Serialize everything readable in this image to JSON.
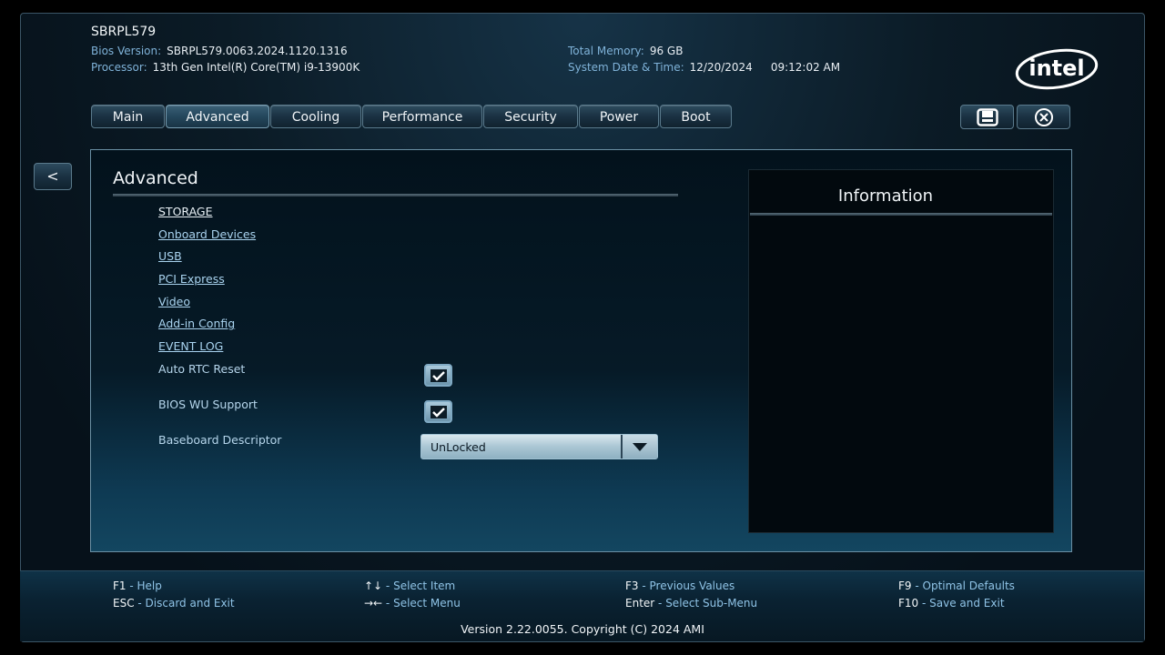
{
  "header": {
    "system_name": "SBRPL579",
    "bios_version_label": "Bios Version:",
    "bios_version_value": "SBRPL579.0063.2024.1120.1316",
    "processor_label": "Processor:",
    "processor_value": "13th Gen Intel(R) Core(TM) i9-13900K",
    "total_memory_label": "Total Memory:",
    "total_memory_value": "96 GB",
    "datetime_label": "System Date & Time:",
    "date_value": "12/20/2024",
    "time_value": "09:12:02 AM",
    "logo_text": "intel"
  },
  "tabs": [
    {
      "label": "Main"
    },
    {
      "label": "Advanced",
      "active": true
    },
    {
      "label": "Cooling"
    },
    {
      "label": "Performance"
    },
    {
      "label": "Security"
    },
    {
      "label": "Power"
    },
    {
      "label": "Boot"
    }
  ],
  "toolbar": {
    "save_icon": "save-icon",
    "close_icon": "close-icon"
  },
  "back_button": {
    "label": "<"
  },
  "panel": {
    "title": "Advanced",
    "links": [
      "STORAGE",
      "Onboard Devices",
      "USB",
      "PCI Express",
      "Video",
      "Add-in Config",
      "EVENT LOG"
    ],
    "options": {
      "auto_rtc_reset": {
        "label": "Auto RTC Reset",
        "checked": true
      },
      "bios_wu_support": {
        "label": "BIOS WU Support",
        "checked": true
      },
      "baseboard_descriptor": {
        "label": "Baseboard Descriptor",
        "value": "UnLocked"
      }
    }
  },
  "info": {
    "title": "Information"
  },
  "footer": {
    "keys": [
      {
        "key": "F1",
        "desc": "Help"
      },
      {
        "key": "ESC",
        "desc": "Discard and Exit"
      },
      {
        "key": "↑↓",
        "desc": "Select Item"
      },
      {
        "key": "→←",
        "desc": "Select Menu"
      },
      {
        "key": "F3",
        "desc": "Previous Values"
      },
      {
        "key": "Enter",
        "desc": "Select Sub-Menu"
      },
      {
        "key": "F9",
        "desc": "Optimal Defaults"
      },
      {
        "key": "F10",
        "desc": "Save and Exit"
      }
    ],
    "version": "Version 2.22.0055. Copyright (C) 2024 AMI"
  },
  "colors": {
    "accent": "#7fb2d8",
    "link": "#a9d3ef",
    "background": "#06111a"
  }
}
